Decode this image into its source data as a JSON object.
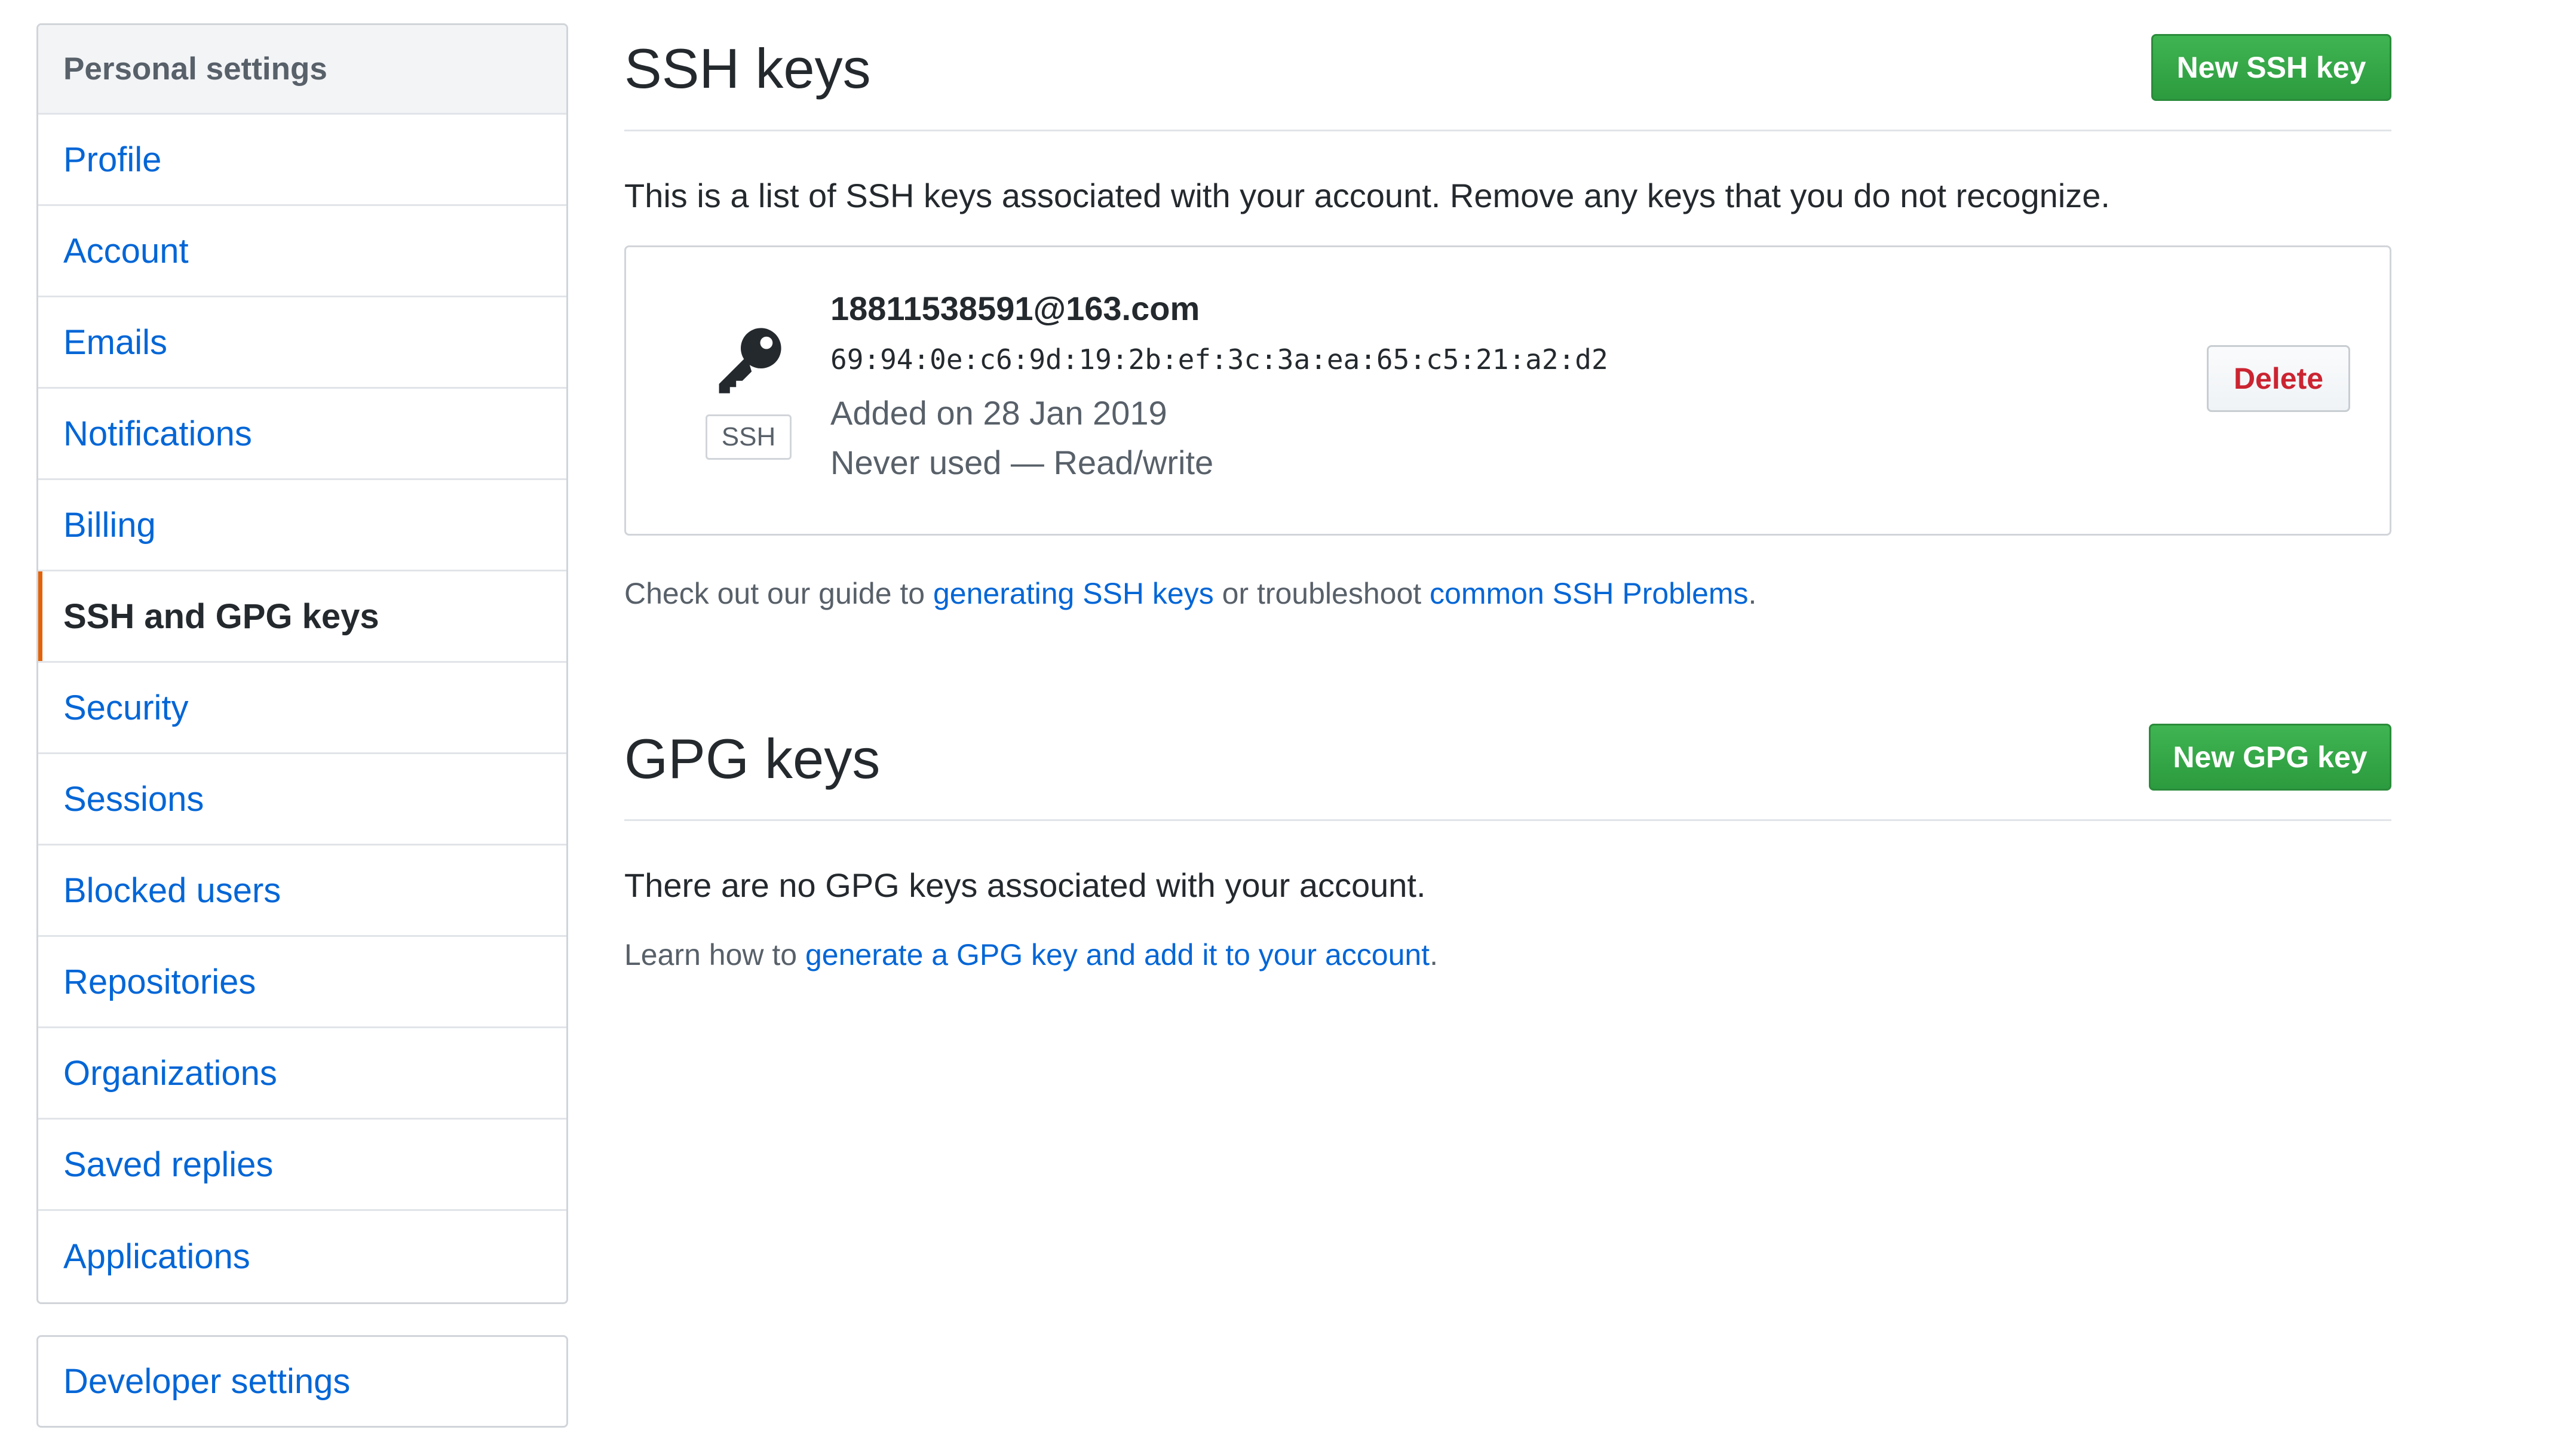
{
  "sidebar": {
    "header": "Personal settings",
    "items": [
      {
        "label": "Profile",
        "selected": false
      },
      {
        "label": "Account",
        "selected": false
      },
      {
        "label": "Emails",
        "selected": false
      },
      {
        "label": "Notifications",
        "selected": false
      },
      {
        "label": "Billing",
        "selected": false
      },
      {
        "label": "SSH and GPG keys",
        "selected": true
      },
      {
        "label": "Security",
        "selected": false
      },
      {
        "label": "Sessions",
        "selected": false
      },
      {
        "label": "Blocked users",
        "selected": false
      },
      {
        "label": "Repositories",
        "selected": false
      },
      {
        "label": "Organizations",
        "selected": false
      },
      {
        "label": "Saved replies",
        "selected": false
      },
      {
        "label": "Applications",
        "selected": false
      }
    ],
    "developer_settings": "Developer settings",
    "selected_accent": "#e36209"
  },
  "ssh": {
    "title": "SSH keys",
    "new_button": "New SSH key",
    "description": "This is a list of SSH keys associated with your account. Remove any keys that you do not recognize.",
    "keys": [
      {
        "icon": "key-icon",
        "badge": "SSH",
        "title": "18811538591@163.com",
        "fingerprint": "69:94:0e:c6:9d:19:2b:ef:3c:3a:ea:65:c5:21:a2:d2",
        "added": "Added on 28 Jan 2019",
        "usage": "Never used — Read/write",
        "delete_label": "Delete"
      }
    ],
    "guide": {
      "prefix": "Check out our guide to ",
      "link1": "generating SSH keys",
      "middle": " or troubleshoot ",
      "link2": "common SSH Problems",
      "suffix": "."
    }
  },
  "gpg": {
    "title": "GPG keys",
    "new_button": "New GPG key",
    "empty_text": "There are no GPG keys associated with your account.",
    "learn": {
      "prefix": "Learn how to ",
      "link": "generate a GPG key and add it to your account",
      "suffix": "."
    }
  },
  "colors": {
    "link": "#0366d6",
    "primary_button": "#2c9b3f",
    "danger": "#cb2431"
  }
}
